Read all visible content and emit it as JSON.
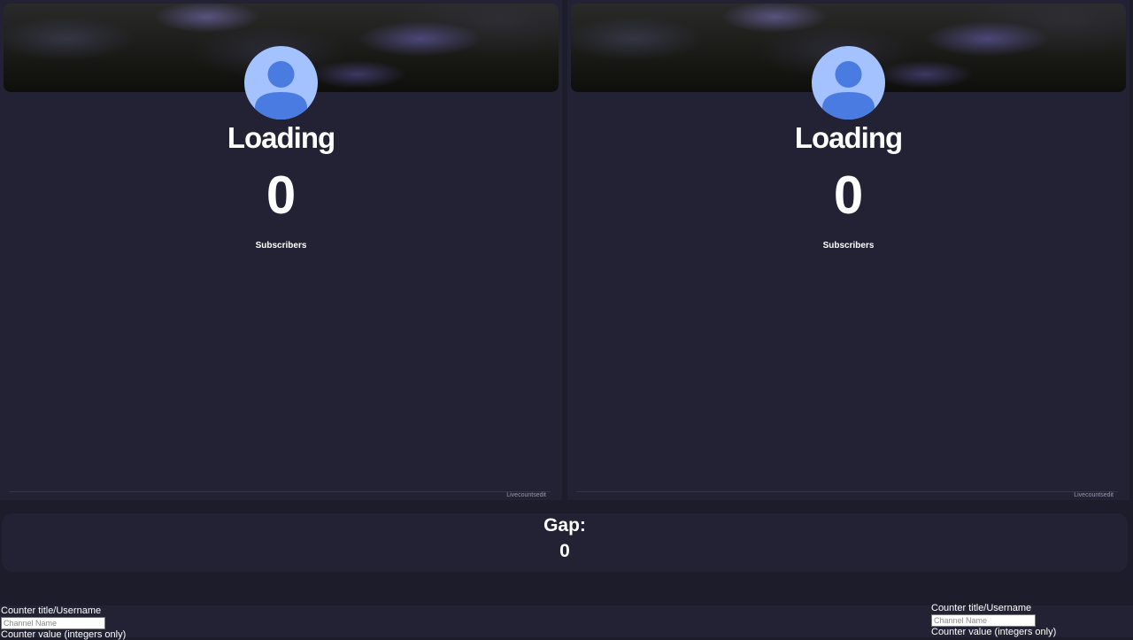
{
  "counters": [
    {
      "name": "Loading",
      "count": "0",
      "unit_label": "Subscribers",
      "watermark": "Livecountsedit"
    },
    {
      "name": "Loading",
      "count": "0",
      "unit_label": "Subscribers",
      "watermark": "Livecountsedit"
    }
  ],
  "gap": {
    "label": "Gap:",
    "value": "0"
  },
  "controls": [
    {
      "title_label": "Counter title/Username",
      "title_placeholder": "Channel Name",
      "value_label": "Counter value (integers only)"
    },
    {
      "title_label": "Counter title/Username",
      "title_placeholder": "Channel Name",
      "value_label": "Counter value (integers only)"
    }
  ],
  "colors": {
    "page_background": "#1c1c2a",
    "card_background": "#222234",
    "avatar_background": "#a3c2ff",
    "avatar_figure": "#4a7be0"
  },
  "icons": {
    "avatar": "default-user-icon"
  }
}
